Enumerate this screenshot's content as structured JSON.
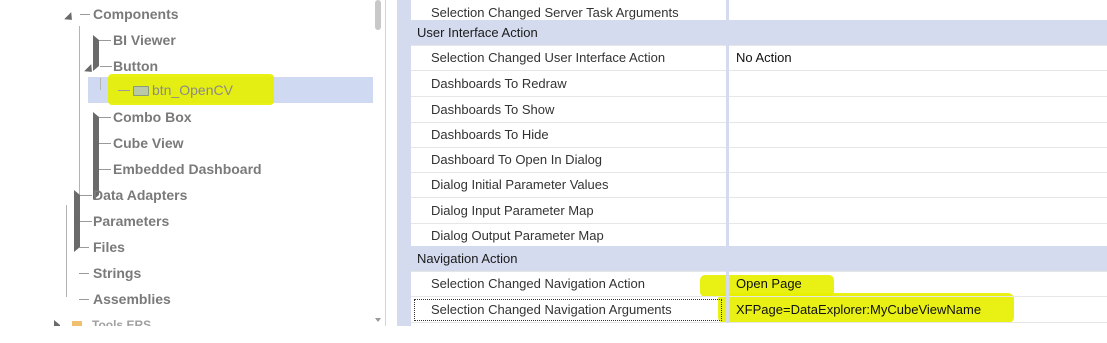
{
  "tree": {
    "items": [
      {
        "label": "Components",
        "state": "expanded"
      },
      {
        "label": "BI Viewer",
        "state": "collapsed"
      },
      {
        "label": "Button",
        "state": "expanded"
      },
      {
        "label": "btn_OpenCV",
        "state": "leaf",
        "selected": true
      },
      {
        "label": "Combo Box",
        "state": "collapsed"
      },
      {
        "label": "Cube View",
        "state": "collapsed"
      },
      {
        "label": "Embedded Dashboard",
        "state": "collapsed"
      },
      {
        "label": "Data Adapters",
        "state": "collapsed"
      },
      {
        "label": "Parameters",
        "state": "collapsed"
      },
      {
        "label": "Files",
        "state": "leaf"
      },
      {
        "label": "Strings",
        "state": "leaf"
      },
      {
        "label": "Assemblies",
        "state": "leaf"
      },
      {
        "label": "Tools ERS",
        "state": "collapsed"
      }
    ]
  },
  "grid": {
    "rows": [
      {
        "name": "Selection Changed Server Task Arguments",
        "value": ""
      },
      {
        "name": "User Interface Action",
        "category": true
      },
      {
        "name": "Selection Changed User Interface Action",
        "value": "No Action"
      },
      {
        "name": "Dashboards To Redraw",
        "value": ""
      },
      {
        "name": "Dashboards To Show",
        "value": ""
      },
      {
        "name": "Dashboards To Hide",
        "value": ""
      },
      {
        "name": "Dashboard To Open In Dialog",
        "value": ""
      },
      {
        "name": "Dialog Initial Parameter Values",
        "value": ""
      },
      {
        "name": "Dialog Input Parameter Map",
        "value": ""
      },
      {
        "name": "Dialog Output Parameter Map",
        "value": ""
      },
      {
        "name": "Navigation Action",
        "category": true
      },
      {
        "name": "Selection Changed Navigation Action",
        "value": "Open Page"
      },
      {
        "name": "Selection Changed Navigation Arguments",
        "value": "XFPage=DataExplorer:MyCubeViewName"
      }
    ]
  },
  "colors": {
    "highlight": "#e7f000",
    "selection": "#cfd9f2",
    "category_bg": "#d4dbee"
  }
}
